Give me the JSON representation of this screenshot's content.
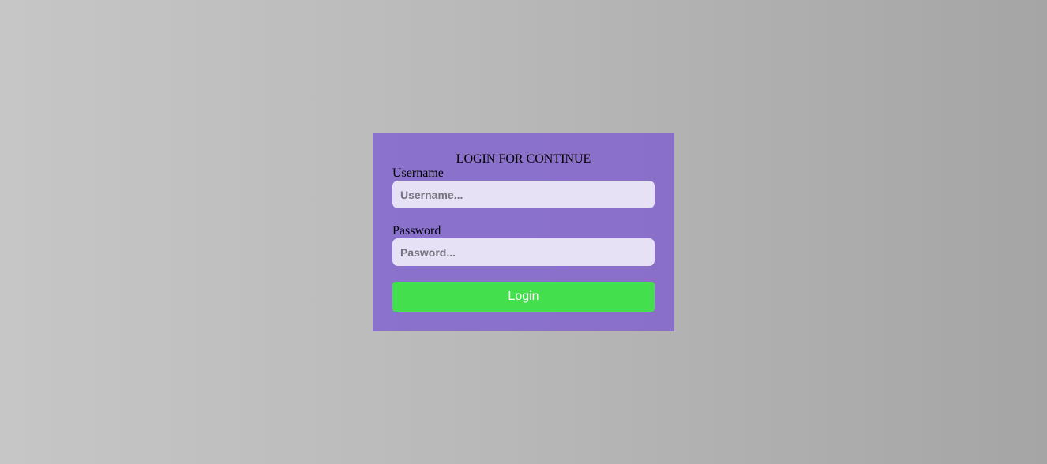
{
  "login_form": {
    "title": "LOGIN FOR CONTINUE",
    "username_label": "Username",
    "username_placeholder": "Username...",
    "password_label": "Password",
    "password_placeholder": "Pasword...",
    "submit_label": "Login"
  },
  "colors": {
    "background_light": "#c6c6c6",
    "background_dark": "#a5a5a5",
    "card": "#8a71ca",
    "input_bg": "#e7e1f5",
    "button": "#43df4d",
    "button_text": "#ffffff"
  }
}
